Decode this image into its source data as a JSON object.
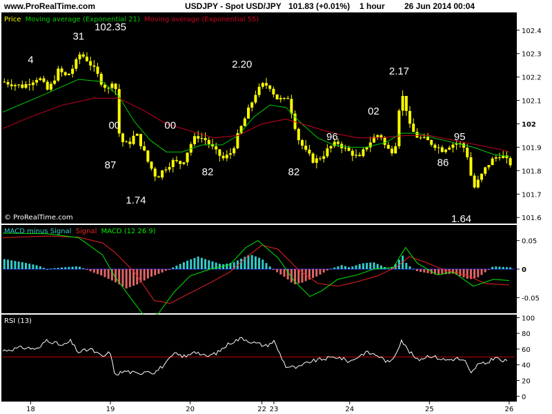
{
  "header": {
    "site": "www.ProRealTime.com",
    "instrument": "USDJPY - Spot USD/JPY",
    "quote": "101.83 (+0.01%)",
    "timeframe": "1 hour",
    "timestamp": "26 Jun 2014 00:04"
  },
  "colors": {
    "background": "#000000",
    "frame": "#ffffff",
    "candle": "#ffff00",
    "ema21": "#00cc00",
    "ema55": "#cc0022",
    "macd_pos": "#33cccc",
    "macd_neg": "#e06666",
    "macd_line": "#00ee00",
    "signal_line": "#ee2222",
    "rsi_line": "#ffffff",
    "rsi_level": "#cc0000",
    "zero_line": "#3333ff"
  },
  "chart_data": [
    {
      "type": "candlestick",
      "legend": {
        "price": "Price",
        "ema21": "Moving average (Exponential 21)",
        "ema55": "Moving average (Exponential 55)"
      },
      "ylim": [
        101.58,
        102.47
      ],
      "yticks": [
        "102.4",
        "102.3",
        "102.2",
        "102.1",
        "102",
        "101.9",
        "101.8",
        "101.7",
        "101.6"
      ],
      "watermark": "© ProRealTime.com",
      "annotations": [
        {
          "text": "4",
          "x": 0.0,
          "y": 102.26
        },
        {
          "text": "31",
          "x": 0.6,
          "y": 102.36
        },
        {
          "text": "102.35",
          "x": 1.0,
          "y": 102.4
        },
        {
          "text": "00",
          "x": 1.05,
          "y": 101.98
        },
        {
          "text": "87",
          "x": 1.0,
          "y": 101.81
        },
        {
          "text": "1.74",
          "x": 1.32,
          "y": 101.66
        },
        {
          "text": "00",
          "x": 1.75,
          "y": 101.98
        },
        {
          "text": "82",
          "x": 2.22,
          "y": 101.78
        },
        {
          "text": "2.20",
          "x": 2.65,
          "y": 102.24
        },
        {
          "text": "96",
          "x": 3.78,
          "y": 101.93
        },
        {
          "text": "82",
          "x": 3.3,
          "y": 101.78
        },
        {
          "text": "02",
          "x": 4.3,
          "y": 102.04
        },
        {
          "text": "2.17",
          "x": 4.62,
          "y": 102.21
        },
        {
          "text": "95",
          "x": 5.38,
          "y": 101.93
        },
        {
          "text": "86",
          "x": 5.17,
          "y": 101.82
        },
        {
          "text": "1.64",
          "x": 5.4,
          "y": 101.58
        }
      ],
      "anchors": [
        [
          -0.35,
          102.18
        ],
        [
          -0.1,
          102.16
        ],
        [
          0.1,
          102.2
        ],
        [
          0.22,
          102.14
        ],
        [
          0.35,
          102.23
        ],
        [
          0.45,
          102.2
        ],
        [
          0.55,
          102.25
        ],
        [
          0.62,
          102.3
        ],
        [
          0.72,
          102.27
        ],
        [
          0.82,
          102.22
        ],
        [
          0.9,
          102.17
        ],
        [
          1.0,
          102.14
        ],
        [
          1.05,
          102.25
        ],
        [
          1.08,
          102.05
        ],
        [
          1.12,
          101.93
        ],
        [
          1.22,
          101.91
        ],
        [
          1.32,
          101.96
        ],
        [
          1.4,
          101.9
        ],
        [
          1.48,
          101.83
        ],
        [
          1.58,
          101.77
        ],
        [
          1.68,
          101.81
        ],
        [
          1.78,
          101.84
        ],
        [
          1.9,
          101.83
        ],
        [
          2.0,
          101.91
        ],
        [
          2.08,
          101.95
        ],
        [
          2.2,
          101.93
        ],
        [
          2.32,
          101.88
        ],
        [
          2.42,
          101.85
        ],
        [
          2.52,
          101.88
        ],
        [
          2.62,
          101.97
        ],
        [
          2.72,
          102.05
        ],
        [
          2.82,
          102.13
        ],
        [
          2.92,
          102.17
        ],
        [
          3.0,
          102.16
        ],
        [
          3.08,
          102.11
        ],
        [
          3.18,
          102.1
        ],
        [
          3.22,
          102.12
        ],
        [
          3.28,
          102.04
        ],
        [
          3.35,
          101.94
        ],
        [
          3.45,
          101.88
        ],
        [
          3.55,
          101.84
        ],
        [
          3.65,
          101.86
        ],
        [
          3.75,
          101.9
        ],
        [
          3.85,
          101.92
        ],
        [
          3.95,
          101.89
        ],
        [
          4.05,
          101.87
        ],
        [
          4.12,
          101.85
        ],
        [
          4.2,
          101.9
        ],
        [
          4.3,
          101.94
        ],
        [
          4.38,
          101.96
        ],
        [
          4.45,
          101.9
        ],
        [
          4.52,
          101.88
        ],
        [
          4.58,
          101.92
        ],
        [
          4.64,
          102.14
        ],
        [
          4.7,
          102.08
        ],
        [
          4.76,
          101.98
        ],
        [
          4.86,
          101.94
        ],
        [
          4.96,
          101.93
        ],
        [
          5.06,
          101.91
        ],
        [
          5.16,
          101.89
        ],
        [
          5.26,
          101.91
        ],
        [
          5.36,
          101.92
        ],
        [
          5.46,
          101.89
        ],
        [
          5.5,
          101.82
        ],
        [
          5.55,
          101.72
        ],
        [
          5.62,
          101.76
        ],
        [
          5.72,
          101.82
        ],
        [
          5.8,
          101.85
        ],
        [
          5.9,
          101.87
        ],
        [
          6.0,
          101.83
        ]
      ],
      "ema21": [
        [
          -0.35,
          102.05
        ],
        [
          0.2,
          102.13
        ],
        [
          0.6,
          102.19
        ],
        [
          0.9,
          102.18
        ],
        [
          1.1,
          102.12
        ],
        [
          1.3,
          102.01
        ],
        [
          1.5,
          101.93
        ],
        [
          1.7,
          101.88
        ],
        [
          1.9,
          101.88
        ],
        [
          2.15,
          101.91
        ],
        [
          2.4,
          101.91
        ],
        [
          2.6,
          101.95
        ],
        [
          2.8,
          102.03
        ],
        [
          3.0,
          102.08
        ],
        [
          3.2,
          102.07
        ],
        [
          3.4,
          102.0
        ],
        [
          3.6,
          101.94
        ],
        [
          3.8,
          101.91
        ],
        [
          4.0,
          101.9
        ],
        [
          4.2,
          101.9
        ],
        [
          4.45,
          101.92
        ],
        [
          4.65,
          101.96
        ],
        [
          4.85,
          101.96
        ],
        [
          5.05,
          101.94
        ],
        [
          5.3,
          101.92
        ],
        [
          5.55,
          101.9
        ],
        [
          5.8,
          101.87
        ],
        [
          6.0,
          101.86
        ]
      ],
      "ema55": [
        [
          -0.35,
          101.98
        ],
        [
          0.0,
          102.03
        ],
        [
          0.4,
          102.08
        ],
        [
          0.8,
          102.11
        ],
        [
          1.1,
          102.11
        ],
        [
          1.4,
          102.06
        ],
        [
          1.7,
          102.0
        ],
        [
          2.0,
          101.97
        ],
        [
          2.3,
          101.94
        ],
        [
          2.6,
          101.95
        ],
        [
          2.9,
          102.0
        ],
        [
          3.2,
          102.02
        ],
        [
          3.5,
          101.99
        ],
        [
          3.8,
          101.96
        ],
        [
          4.1,
          101.94
        ],
        [
          4.4,
          101.94
        ],
        [
          4.7,
          101.95
        ],
        [
          5.0,
          101.95
        ],
        [
          5.3,
          101.93
        ],
        [
          5.6,
          101.91
        ],
        [
          5.9,
          101.89
        ],
        [
          6.0,
          101.88
        ]
      ]
    },
    {
      "type": "bar",
      "legend": {
        "macd_minus_signal": "MACD minus Signal",
        "signal": "Signal",
        "macd": "MACD (12 26 9)"
      },
      "ylim": [
        -0.075,
        0.075
      ],
      "yticks": [
        "0.05",
        "0",
        "-0.05"
      ],
      "histogram": [
        [
          -0.35,
          0.018
        ],
        [
          -0.1,
          0.012
        ],
        [
          0.1,
          0.006
        ],
        [
          0.2,
          0.0
        ],
        [
          0.4,
          0.003
        ],
        [
          0.6,
          0.005
        ],
        [
          0.75,
          -0.004
        ],
        [
          0.9,
          -0.012
        ],
        [
          1.05,
          -0.022
        ],
        [
          1.2,
          -0.034
        ],
        [
          1.35,
          -0.026
        ],
        [
          1.5,
          -0.014
        ],
        [
          1.65,
          -0.006
        ],
        [
          1.8,
          0.004
        ],
        [
          1.95,
          0.014
        ],
        [
          2.1,
          0.022
        ],
        [
          2.2,
          0.017
        ],
        [
          2.4,
          0.008
        ],
        [
          2.55,
          0.012
        ],
        [
          2.75,
          0.026
        ],
        [
          2.9,
          0.018
        ],
        [
          3.05,
          -0.002
        ],
        [
          3.2,
          -0.015
        ],
        [
          3.3,
          -0.027
        ],
        [
          3.4,
          -0.024
        ],
        [
          3.6,
          -0.012
        ],
        [
          3.75,
          0.0
        ],
        [
          3.9,
          0.007
        ],
        [
          4.0,
          0.003
        ],
        [
          4.15,
          0.01
        ],
        [
          4.3,
          0.012
        ],
        [
          4.5,
          0.0
        ],
        [
          4.6,
          0.012
        ],
        [
          4.66,
          0.025
        ],
        [
          4.72,
          0.008
        ],
        [
          4.85,
          -0.004
        ],
        [
          5.1,
          -0.01
        ],
        [
          5.3,
          -0.008
        ],
        [
          5.5,
          -0.018
        ],
        [
          5.62,
          -0.014
        ],
        [
          5.8,
          0.005
        ],
        [
          6.0,
          0.003
        ]
      ],
      "macd": [
        [
          -0.35,
          0.063
        ],
        [
          0.2,
          0.062
        ],
        [
          0.6,
          0.055
        ],
        [
          0.9,
          0.025
        ],
        [
          1.05,
          -0.012
        ],
        [
          1.25,
          -0.05
        ],
        [
          1.45,
          -0.087
        ],
        [
          1.6,
          -0.078
        ],
        [
          1.8,
          -0.04
        ],
        [
          2.0,
          -0.012
        ],
        [
          2.25,
          0.0
        ],
        [
          2.5,
          0.008
        ],
        [
          2.7,
          0.038
        ],
        [
          2.85,
          0.05
        ],
        [
          3.1,
          0.02
        ],
        [
          3.3,
          -0.02
        ],
        [
          3.5,
          -0.048
        ],
        [
          3.65,
          -0.038
        ],
        [
          3.85,
          -0.018
        ],
        [
          4.1,
          -0.01
        ],
        [
          4.3,
          0.0
        ],
        [
          4.55,
          0.003
        ],
        [
          4.7,
          0.038
        ],
        [
          4.85,
          0.01
        ],
        [
          5.1,
          -0.01
        ],
        [
          5.3,
          -0.005
        ],
        [
          5.55,
          -0.03
        ],
        [
          5.8,
          -0.018
        ],
        [
          6.0,
          -0.02
        ]
      ],
      "signal": [
        [
          -0.35,
          0.055
        ],
        [
          0.2,
          0.058
        ],
        [
          0.6,
          0.056
        ],
        [
          0.9,
          0.046
        ],
        [
          1.05,
          0.03
        ],
        [
          1.3,
          -0.005
        ],
        [
          1.55,
          -0.055
        ],
        [
          1.75,
          -0.06
        ],
        [
          2.0,
          -0.042
        ],
        [
          2.25,
          -0.024
        ],
        [
          2.5,
          -0.005
        ],
        [
          2.7,
          0.02
        ],
        [
          2.9,
          0.042
        ],
        [
          3.1,
          0.035
        ],
        [
          3.35,
          0.0
        ],
        [
          3.6,
          -0.025
        ],
        [
          3.85,
          -0.03
        ],
        [
          4.1,
          -0.022
        ],
        [
          4.35,
          -0.012
        ],
        [
          4.6,
          0.005
        ],
        [
          4.75,
          0.022
        ],
        [
          4.95,
          0.012
        ],
        [
          5.2,
          -0.002
        ],
        [
          5.45,
          -0.01
        ],
        [
          5.7,
          -0.025
        ],
        [
          6.0,
          -0.028
        ]
      ]
    },
    {
      "type": "line",
      "legend": "RSI (13)",
      "ylim": [
        -5,
        102
      ],
      "yticks": [
        "100",
        "80",
        "60",
        "40",
        "20",
        "0"
      ],
      "level": 50,
      "values": [
        [
          -0.35,
          58
        ],
        [
          -0.1,
          62
        ],
        [
          0.1,
          60
        ],
        [
          0.2,
          72
        ],
        [
          0.4,
          64
        ],
        [
          0.5,
          70
        ],
        [
          0.6,
          56
        ],
        [
          0.75,
          60
        ],
        [
          0.9,
          50
        ],
        [
          1.0,
          56
        ],
        [
          1.05,
          28
        ],
        [
          1.2,
          32
        ],
        [
          1.35,
          28
        ],
        [
          1.45,
          33
        ],
        [
          1.55,
          30
        ],
        [
          1.7,
          42
        ],
        [
          1.8,
          54
        ],
        [
          1.95,
          50
        ],
        [
          2.05,
          58
        ],
        [
          2.2,
          50
        ],
        [
          2.35,
          56
        ],
        [
          2.5,
          68
        ],
        [
          2.65,
          74
        ],
        [
          2.8,
          68
        ],
        [
          2.95,
          64
        ],
        [
          3.05,
          70
        ],
        [
          3.2,
          38
        ],
        [
          3.35,
          36
        ],
        [
          3.5,
          44
        ],
        [
          3.7,
          48
        ],
        [
          3.85,
          50
        ],
        [
          4.0,
          44
        ],
        [
          4.2,
          56
        ],
        [
          4.35,
          52
        ],
        [
          4.5,
          42
        ],
        [
          4.58,
          55
        ],
        [
          4.65,
          72
        ],
        [
          4.72,
          60
        ],
        [
          4.85,
          46
        ],
        [
          5.0,
          52
        ],
        [
          5.2,
          46
        ],
        [
          5.35,
          48
        ],
        [
          5.45,
          44
        ],
        [
          5.52,
          28
        ],
        [
          5.6,
          40
        ],
        [
          5.72,
          42
        ],
        [
          5.82,
          50
        ],
        [
          5.92,
          44
        ],
        [
          6.0,
          46
        ]
      ]
    }
  ],
  "xaxis": {
    "ticks": [
      {
        "label": "18",
        "x": 0
      },
      {
        "label": "19",
        "x": 1
      },
      {
        "label": "20",
        "x": 2
      },
      {
        "label": "22",
        "x": 2.9
      },
      {
        "label": "23",
        "x": 3.05
      },
      {
        "label": "24",
        "x": 4
      },
      {
        "label": "25",
        "x": 5
      },
      {
        "label": "26",
        "x": 6
      }
    ]
  }
}
